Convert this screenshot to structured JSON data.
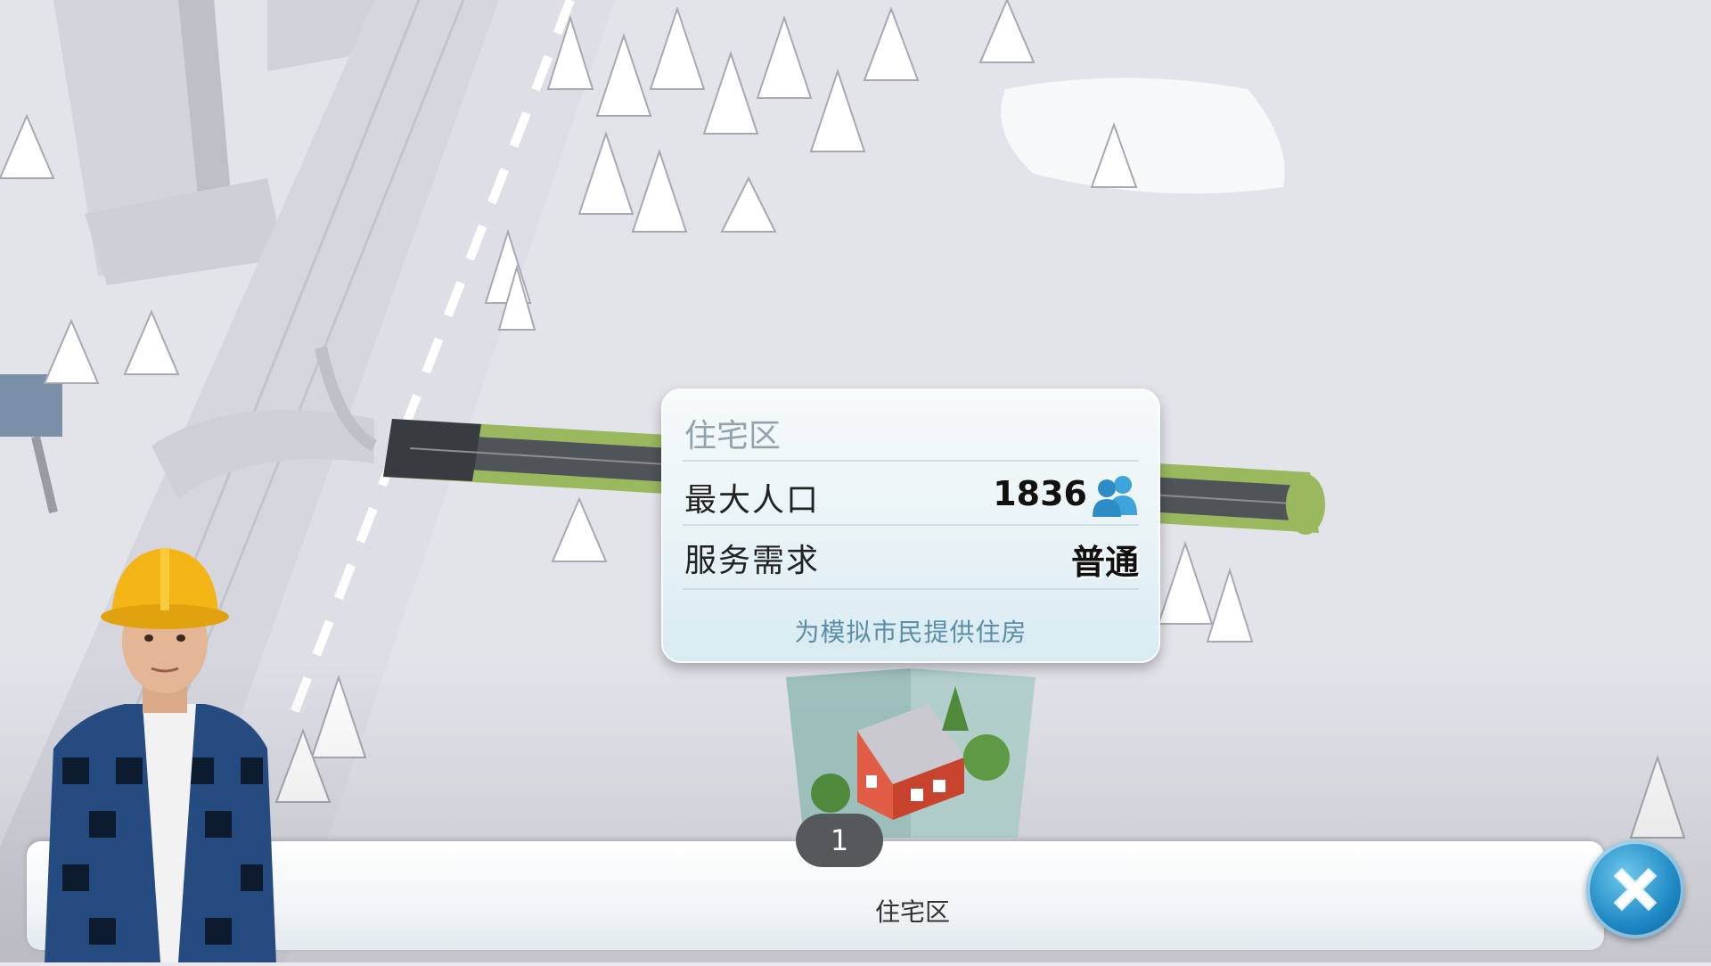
{
  "tooltip": {
    "title": "住宅区",
    "rows": [
      {
        "label": "最大人口",
        "value": "1836",
        "icon": "population-icon"
      },
      {
        "label": "服务需求",
        "value": "普通"
      }
    ],
    "description": "为模拟市民提供住房"
  },
  "build_bar": {
    "item_count": "1",
    "item_label": "住宅区"
  },
  "colors": {
    "accent_blue": "#1c86c2",
    "tooltip_desc": "#5b8ea6",
    "badge_bg": "#56595c"
  }
}
